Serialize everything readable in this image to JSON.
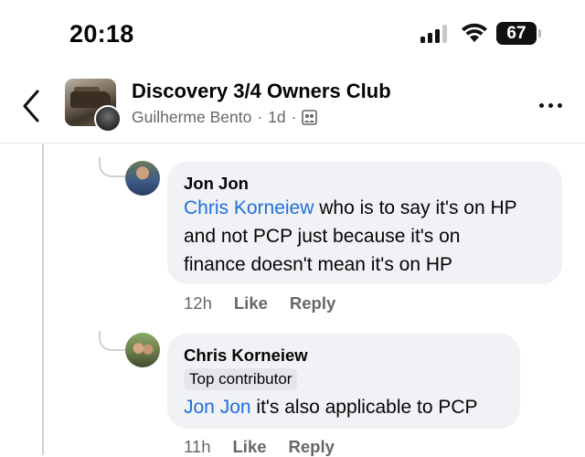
{
  "status_bar": {
    "time": "20:18",
    "battery": "67"
  },
  "header": {
    "group_name": "Discovery 3/4 Owners Club",
    "poster": "Guilherme Bento",
    "separator": "·",
    "age": "1d",
    "separator2": "·",
    "privacy_icon": "group-members-icon"
  },
  "comments": [
    {
      "author": "Jon Jon",
      "mention": "Chris Korneiew",
      "text_lines": [
        " who is to say it's on HP",
        "and not PCP just because it's on",
        "finance doesn't mean it's on HP"
      ],
      "time": "12h",
      "like": "Like",
      "reply": "Reply"
    },
    {
      "author": "Chris Korneiew",
      "badge": "Top contributor",
      "mention": "Jon Jon",
      "text": " it's also applicable to PCP",
      "time": "11h",
      "like": "Like",
      "reply": "Reply"
    }
  ],
  "colors": {
    "mention": "#216fdb",
    "bubble": "#f0f2f5",
    "meta": "#65676b"
  }
}
